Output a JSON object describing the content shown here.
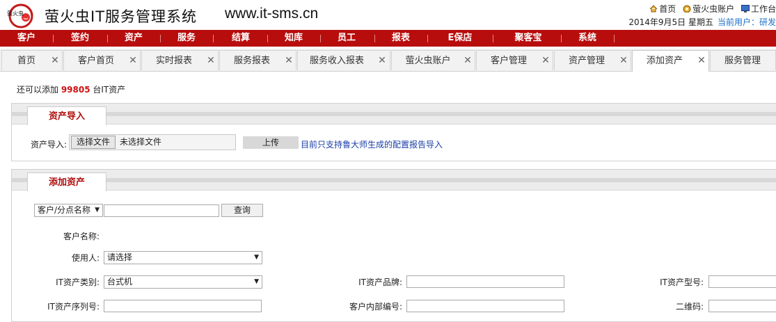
{
  "header": {
    "logo_text": "萤火虫",
    "brand": "萤火虫IT服务管理系统",
    "site": "www.it-sms.cn",
    "links": [
      {
        "icon": "home-icon",
        "label": "首页"
      },
      {
        "icon": "account-icon",
        "label": "萤火虫账户"
      },
      {
        "icon": "monitor-icon",
        "label": "工作台"
      }
    ],
    "date": "2014年9月5日 星期五",
    "current_user_label": "当前用户：",
    "current_user": "研发"
  },
  "nav": [
    "客户",
    "签约",
    "资产",
    "服务",
    "结算",
    "知库",
    "员工",
    "报表",
    "E保店",
    "聚客宝",
    "系统"
  ],
  "tabs": [
    {
      "label": "首页",
      "close": "✕"
    },
    {
      "label": "客户首页",
      "close": "✕"
    },
    {
      "label": "实时报表",
      "close": "✕"
    },
    {
      "label": "服务报表",
      "close": "✕"
    },
    {
      "label": "服务收入报表",
      "close": "✕"
    },
    {
      "label": "萤火虫账户",
      "close": "✕"
    },
    {
      "label": "客户管理",
      "close": "✕"
    },
    {
      "label": "资产管理",
      "close": "✕"
    },
    {
      "label": "添加资产",
      "close": "✕"
    },
    {
      "label": "服务管理",
      "close": ""
    }
  ],
  "quota": {
    "prefix": "还可以添加 ",
    "count": "99805",
    "suffix": " 台IT资产"
  },
  "import_panel": {
    "tab": "资产导入",
    "label": "资产导入:",
    "file_button": "选择文件",
    "file_status": "未选择文件",
    "upload": "上传",
    "note": "目前只支持鲁大师生成的配置报告导入"
  },
  "add_panel": {
    "tab": "添加资产",
    "search_select": "客户/分点名称",
    "search_button": "查询",
    "customer_name_label": "客户名称:",
    "user_label": "使用人:",
    "user_select": "请选择",
    "category_label": "IT资产类别:",
    "category_select": "台式机",
    "brand_label": "IT资产品牌:",
    "model_label": "IT资产型号:",
    "serial_label": "IT资产序列号:",
    "internal_no_label": "客户内部编号:",
    "qrcode_label": "二维码:"
  }
}
